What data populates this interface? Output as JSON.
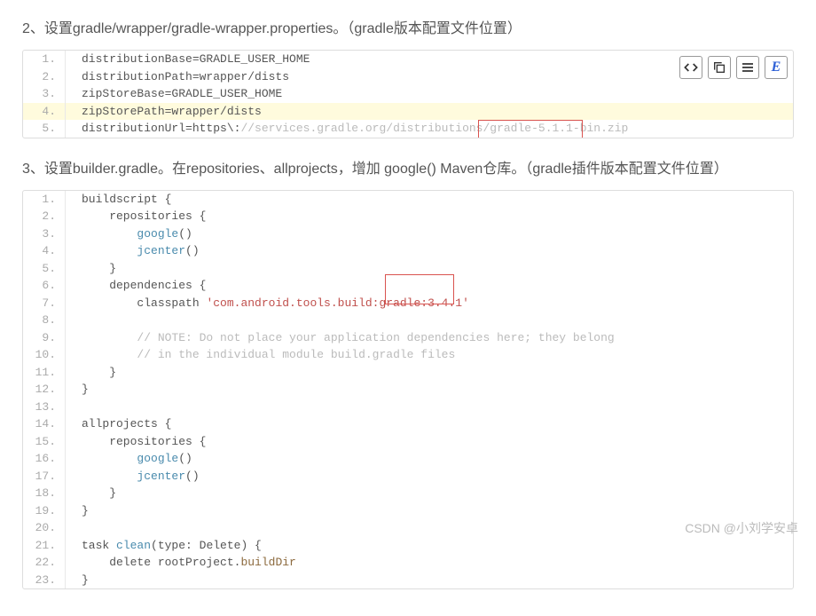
{
  "section2": {
    "heading": "2、设置gradle/wrapper/gradle-wrapper.properties。（gradle版本配置文件位置）",
    "lines": [
      {
        "n": "1.",
        "t": "distributionBase=GRADLE_USER_HOME"
      },
      {
        "n": "2.",
        "t": "distributionPath=wrapper/dists"
      },
      {
        "n": "3.",
        "t": "zipStoreBase=GRADLE_USER_HOME"
      },
      {
        "n": "4.",
        "t": "zipStorePath=wrapper/dists",
        "hl": true
      },
      {
        "n": "5.",
        "pre": "distributionUrl=https\\:",
        "cmt": "//services.gradle.org/distributions/gradle-5.1.1-bin.zip"
      }
    ]
  },
  "section3": {
    "heading": "3、设置builder.gradle。在repositories、allprojects，增加 google() Maven仓库。（gradle插件版本配置文件位置）",
    "classpath_str": "'com.android.tools.build:gradle:3.4.1'",
    "comment1": "// NOTE: Do not place your application dependencies here; they belong",
    "comment2": "// in the individual module build.gradle files"
  },
  "toolbar": {
    "code": "code-icon",
    "copy": "copy-icon",
    "wrap": "wrap-icon",
    "e": "E"
  },
  "watermark": "CSDN @小刘学安卓",
  "gutters": [
    "1.",
    "2.",
    "3.",
    "4.",
    "5.",
    "6.",
    "7.",
    "8.",
    "9.",
    "10.",
    "11.",
    "12.",
    "13.",
    "14.",
    "15.",
    "16.",
    "17.",
    "18.",
    "19.",
    "20.",
    "21.",
    "22.",
    "23."
  ]
}
